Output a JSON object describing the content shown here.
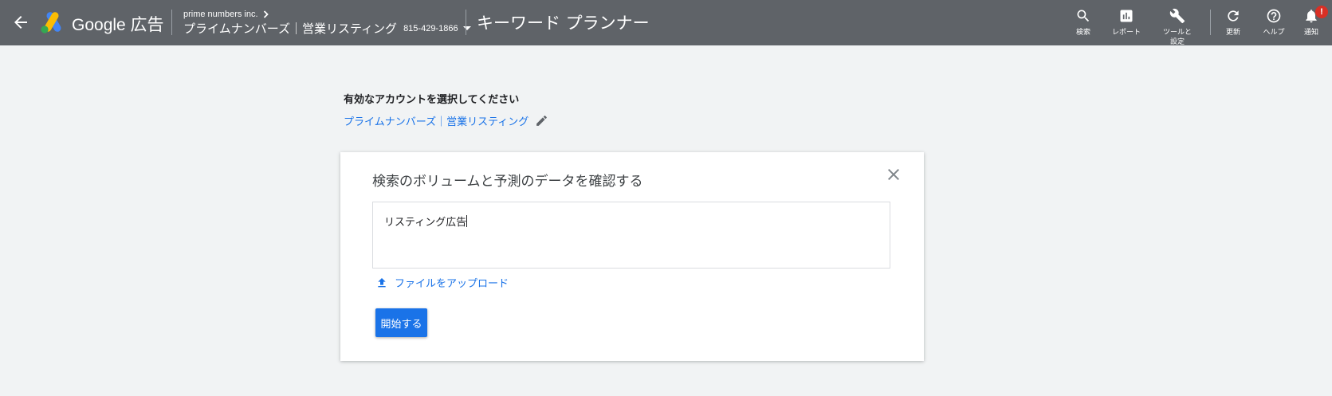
{
  "header": {
    "brand": "Google 広告",
    "account_company": "prime numbers inc.",
    "account_name": "プライムナンバーズ｜営業リスティング",
    "account_id": "815-429-1866",
    "page_title": "キーワード プランナー",
    "tools": [
      {
        "label": "検索",
        "icon": "search-icon"
      },
      {
        "label": "レポート",
        "icon": "report-icon"
      },
      {
        "label": "ツールと\n設定",
        "icon": "wrench-icon"
      },
      {
        "label": "更新",
        "icon": "refresh-icon"
      },
      {
        "label": "ヘルプ",
        "icon": "help-icon"
      },
      {
        "label": "通知",
        "icon": "bell-icon"
      }
    ],
    "notification_badge": "!"
  },
  "account_select": {
    "title": "有効なアカウントを選択してください",
    "selected": "プライムナンバーズ｜営業リスティング"
  },
  "card": {
    "title": "検索のボリュームと予測のデータを確認する",
    "keyword_value": "リスティング広告",
    "upload_label": "ファイルをアップロード",
    "start_label": "開始する"
  },
  "colors": {
    "topbar": "#5f6368",
    "accent": "#1a73e8",
    "background": "#f1f3f4",
    "badge": "#d93025"
  }
}
